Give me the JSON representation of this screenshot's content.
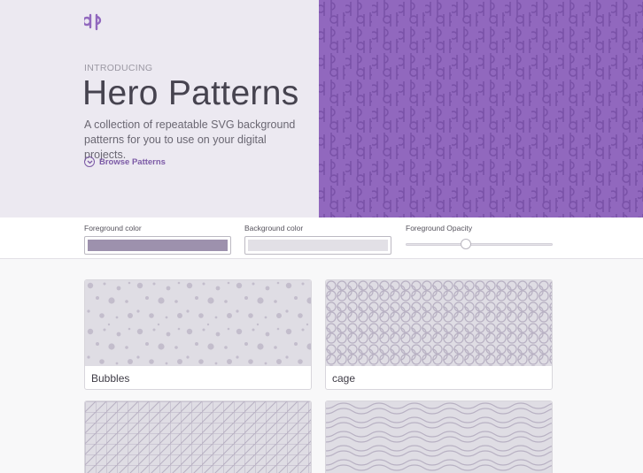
{
  "hero": {
    "eyebrow": "INTRODUCING",
    "title": "Hero Patterns",
    "subtitle": "A collection of repeatable SVG background patterns for you to use on your digital projects.",
    "browse_label": "Browse Patterns",
    "accent_color": "#9168be",
    "background_color": "#ece9f1"
  },
  "controls": {
    "foreground_label": "Foreground color",
    "foreground_value": "#9d91ad",
    "background_label": "Background color",
    "background_value": "#e2e0e6",
    "opacity_label": "Foreground Opacity",
    "opacity_value": 0.4
  },
  "patterns": [
    {
      "name": "Bubbles"
    },
    {
      "name": "cage"
    },
    {
      "name": ""
    },
    {
      "name": ""
    }
  ]
}
